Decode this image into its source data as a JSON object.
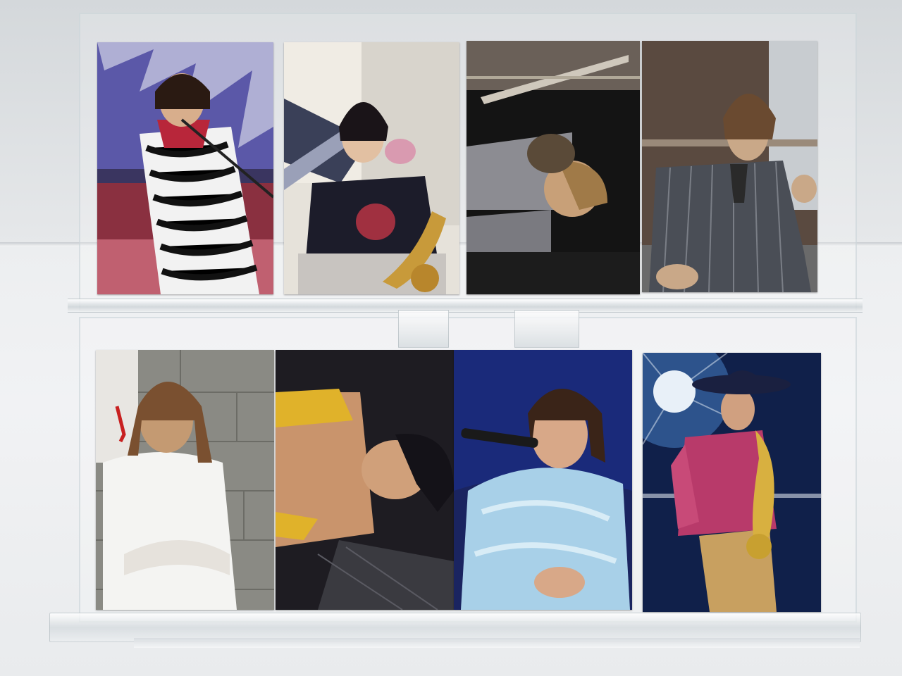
{
  "scene": {
    "subject": "photo-display",
    "background_color": "#e9ebed",
    "photos": [
      {
        "id": "p1",
        "theme": "performer-zebra-coat-microphone",
        "colors": [
          "#1a1a1a",
          "#f2f2f2",
          "#b8263a",
          "#6a5aa8"
        ]
      },
      {
        "id": "p2",
        "theme": "seated-with-saxophone",
        "colors": [
          "#1c1c2a",
          "#e6e0d8",
          "#c89a3a",
          "#d99ab0"
        ]
      },
      {
        "id": "p3",
        "theme": "two-people-dark-room-rotated",
        "colors": [
          "#141414",
          "#8c8c92",
          "#c8a078",
          "#5a4a38"
        ]
      },
      {
        "id": "p4",
        "theme": "seated-pinstripe-suit",
        "colors": [
          "#4a4e56",
          "#7a7e86",
          "#2a2a2a",
          "#c9a888"
        ]
      },
      {
        "id": "p5",
        "theme": "white-tshirt-against-wall",
        "colors": [
          "#f4f4f2",
          "#8a8a84",
          "#c49a72",
          "#3a3a3a"
        ]
      },
      {
        "id": "p6",
        "theme": "shirtless-rotated-portrait",
        "colors": [
          "#1e1c22",
          "#c9946c",
          "#e0b22a",
          "#3a3a40"
        ]
      },
      {
        "id": "p7",
        "theme": "singer-blue-stage-microphone",
        "colors": [
          "#1a2a7a",
          "#a8d0e8",
          "#d8a888",
          "#0c1030"
        ]
      },
      {
        "id": "p8",
        "theme": "saxophone-cowboy-hat-red-jacket",
        "colors": [
          "#10204a",
          "#b83a6a",
          "#c8a060",
          "#e8f0f8"
        ]
      }
    ]
  }
}
